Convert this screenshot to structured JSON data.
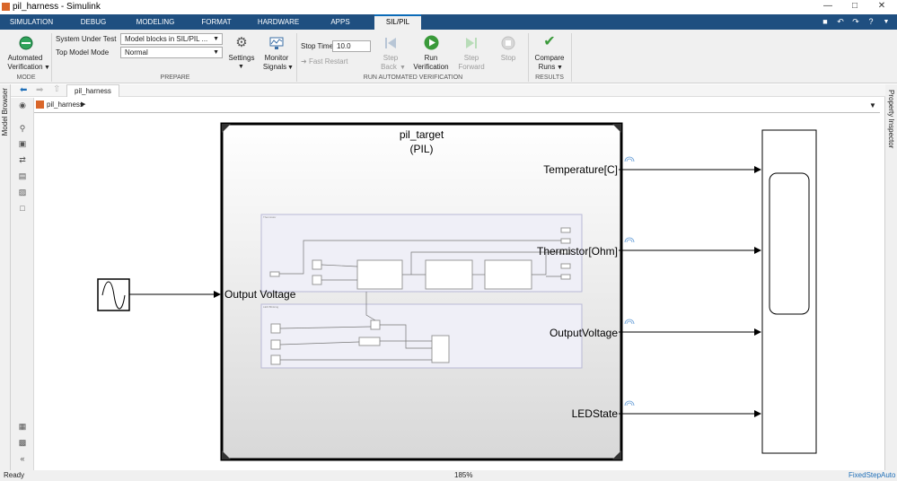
{
  "window": {
    "title": "pil_harness - Simulink"
  },
  "tabs": [
    "SIMULATION",
    "DEBUG",
    "MODELING",
    "FORMAT",
    "HARDWARE",
    "APPS",
    "SIL/PIL"
  ],
  "active_tab": "SIL/PIL",
  "toolstrip": {
    "mode": {
      "button_line1": "Automated",
      "button_line2": "Verification",
      "section": "MODE"
    },
    "prepare": {
      "sut_label": "System Under Test",
      "sut_value": "Model blocks in SIL/PIL ...",
      "topmode_label": "Top Model Mode",
      "topmode_value": "Normal",
      "settings": "Settings",
      "monitor1": "Monitor",
      "monitor2": "Signals",
      "section": "PREPARE"
    },
    "run": {
      "stop_time_label": "Stop Time",
      "stop_time_value": "10.0",
      "fast_restart": "Fast Restart",
      "step_back1": "Step",
      "step_back2": "Back",
      "run1": "Run",
      "run2": "Verification",
      "step_fwd1": "Step",
      "step_fwd2": "Forward",
      "stop": "Stop",
      "section": "RUN AUTOMATED VERIFICATION"
    },
    "results": {
      "compare1": "Compare",
      "compare2": "Runs",
      "section": "RESULTS"
    }
  },
  "side_panels": {
    "left": "Model Browser",
    "right": "Property Inspector"
  },
  "nav_tab": "pil_harness",
  "breadcrumb": "pil_harness",
  "diagram": {
    "subsystem_name": "pil_target",
    "subsystem_mode": "(PIL)",
    "input_port": "Output Voltage",
    "output_ports": [
      "Temperature[C]",
      "Thermistor[Ohm]",
      "OutputVoltage",
      "LEDState"
    ],
    "inner_top_title": "Thermistor",
    "inner_bottom_title": "LED Blinking"
  },
  "status": {
    "left": "Ready",
    "zoom": "185%",
    "solver": "FixedStepAuto"
  },
  "colors": {
    "tab_bar": "#1f4f80",
    "tab_accent": "#0b6bb8",
    "run_green": "#3a9a3a",
    "subsystem_fill": "#efeff7"
  }
}
